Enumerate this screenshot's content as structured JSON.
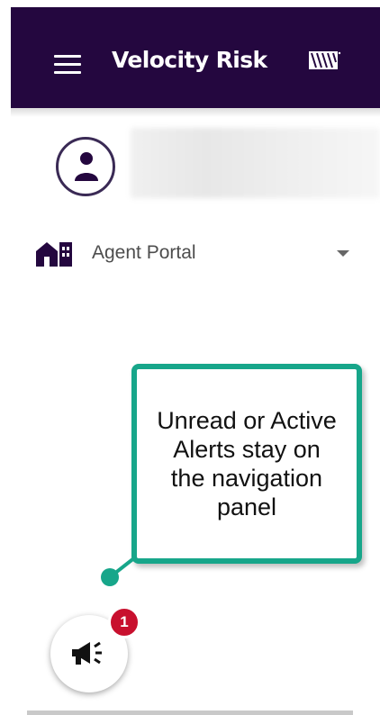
{
  "header": {
    "brand": "Velocity Risk",
    "background": "#24073f"
  },
  "icons": {
    "menu": "hamburger-icon",
    "logo": "logo-mark-icon",
    "user": "user-icon",
    "home": "house-icon",
    "dropdown": "chevron-down-icon",
    "alerts": "megaphone-icon"
  },
  "nav": {
    "portal_label": "Agent Portal"
  },
  "callout": {
    "text": "Unread or Active Alerts stay on the navigation panel",
    "border_color": "#17a68a"
  },
  "alerts": {
    "badge_count": "1",
    "badge_color": "#c8102e"
  }
}
